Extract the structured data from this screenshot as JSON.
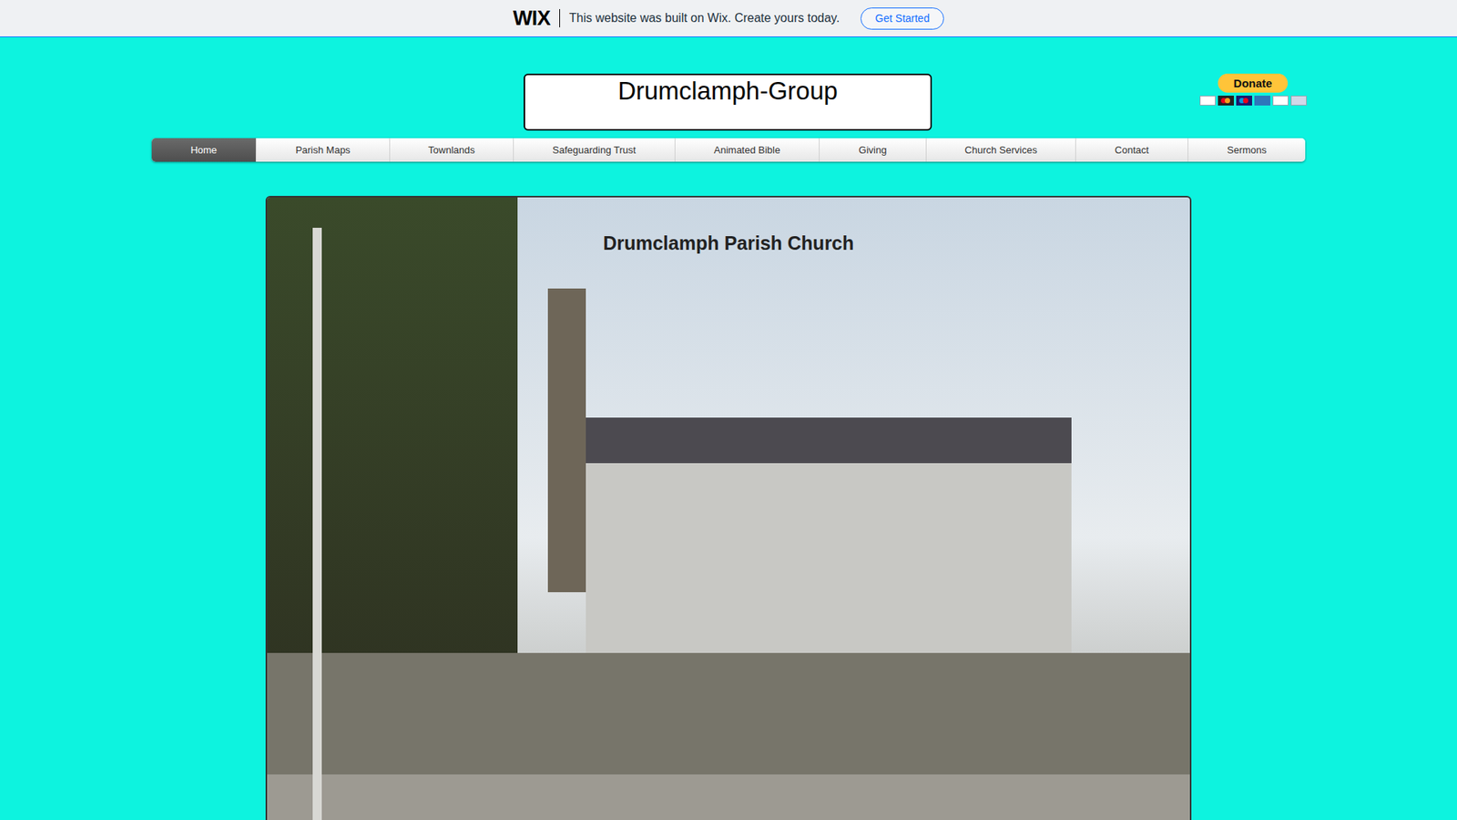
{
  "banner": {
    "logo": "WIX",
    "message": "This website was built on Wix. Create yours today.",
    "button": "Get Started"
  },
  "site_title": "Drumclamph-Group",
  "donate": {
    "label": "Donate"
  },
  "nav": [
    {
      "label": "Home",
      "selected": true
    },
    {
      "label": "Parish Maps",
      "selected": false
    },
    {
      "label": "Townlands",
      "selected": false
    },
    {
      "label": "Safeguarding Trust",
      "selected": false
    },
    {
      "label": "Animated Bible",
      "selected": false
    },
    {
      "label": "Giving",
      "selected": false
    },
    {
      "label": "Church Services",
      "selected": false
    },
    {
      "label": "Contact",
      "selected": false
    },
    {
      "label": "Sermons",
      "selected": false
    }
  ],
  "hero": {
    "title": "Drumclamph Parish Church"
  }
}
